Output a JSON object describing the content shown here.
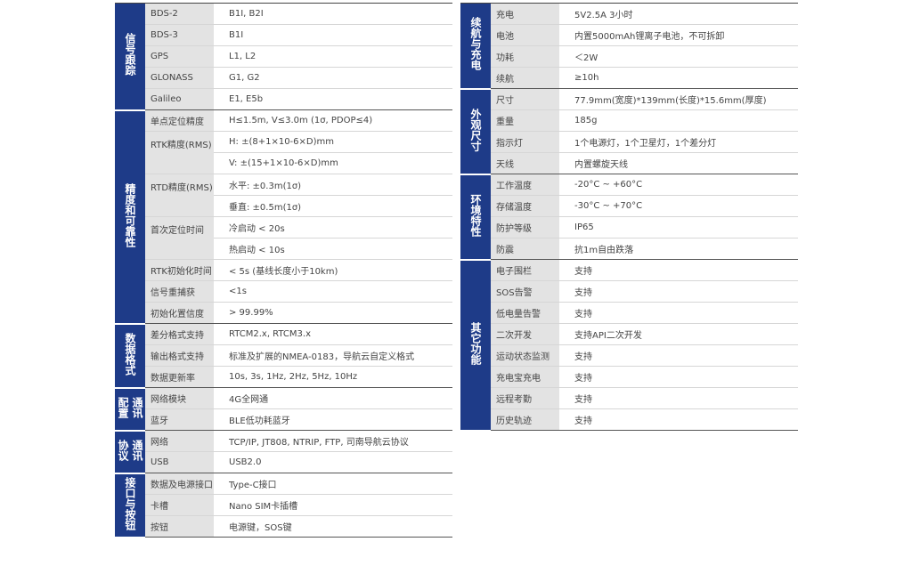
{
  "left": [
    {
      "category": "信号跟踪",
      "layout": "single",
      "rows": [
        {
          "label": "BDS-2",
          "value": "B1I, B2I"
        },
        {
          "label": "BDS-3",
          "value": "B1I"
        },
        {
          "label": "GPS",
          "value": "L1, L2"
        },
        {
          "label": "GLONASS",
          "value": "G1, G2"
        },
        {
          "label": "Galileo",
          "value": "E1, E5b"
        }
      ]
    },
    {
      "category": "精度和可靠性",
      "layout": "single",
      "rows": [
        {
          "label": "单点定位精度",
          "value": "H≤1.5m, V≤3.0m (1σ, PDOP≤4)"
        },
        {
          "label": "RTK精度(RMS)",
          "values": [
            "H: ±(8+1×10-6×D)mm",
            "V: ±(15+1×10-6×D)mm"
          ]
        },
        {
          "label": "RTD精度(RMS)",
          "values": [
            "水平: ±0.3m(1σ)",
            "垂直: ±0.5m(1σ)"
          ]
        },
        {
          "label": "首次定位时间",
          "values": [
            "冷启动 < 20s",
            "热启动 < 10s"
          ]
        },
        {
          "label": "RTK初始化时间",
          "value": "< 5s (基线长度小于10km)"
        },
        {
          "label": "信号重捕获",
          "value": "<1s"
        },
        {
          "label": "初始化置信度",
          "value": "> 99.99%"
        }
      ]
    },
    {
      "category": "数据格式",
      "layout": "single",
      "rows": [
        {
          "label": "差分格式支持",
          "value": "RTCM2.x, RTCM3.x"
        },
        {
          "label": "输出格式支持",
          "value": "标准及扩展的NMEA-0183，导航云自定义格式"
        },
        {
          "label": "数据更新率",
          "value": "10s, 3s, 1Hz, 2Hz, 5Hz, 10Hz"
        }
      ]
    },
    {
      "category": "通讯配置",
      "layout": "double",
      "rows": [
        {
          "label": "网络模块",
          "value": "4G全网通"
        },
        {
          "label": "蓝牙",
          "value": "BLE低功耗蓝牙"
        }
      ]
    },
    {
      "category": "通讯协议",
      "layout": "double",
      "rows": [
        {
          "label": "网络",
          "value": "TCP/IP, JT808, NTRIP, FTP, 司南导航云协议"
        },
        {
          "label": "USB",
          "value": "USB2.0"
        }
      ]
    },
    {
      "category": "接口与按钮",
      "layout": "single",
      "rows": [
        {
          "label": "数据及电源接口",
          "value": "Type-C接口"
        },
        {
          "label": "卡槽",
          "value": "Nano SIM卡插槽"
        },
        {
          "label": "按钮",
          "value": "电源键，SOS键"
        }
      ]
    }
  ],
  "right": [
    {
      "category": "续航与充电",
      "layout": "single",
      "rows": [
        {
          "label": "充电",
          "value": "5V2.5A  3小时"
        },
        {
          "label": "电池",
          "value": "内置5000mAh锂离子电池，不可拆卸"
        },
        {
          "label": "功耗",
          "value": "＜2W"
        },
        {
          "label": "续航",
          "value": "≥10h"
        }
      ]
    },
    {
      "category": "外观尺寸",
      "layout": "single",
      "rows": [
        {
          "label": "尺寸",
          "value": "77.9mm(宽度)*139mm(长度)*15.6mm(厚度)"
        },
        {
          "label": "重量",
          "value": "185g"
        },
        {
          "label": "指示灯",
          "value": "1个电源灯，1个卫星灯，1个差分灯"
        },
        {
          "label": "天线",
          "value": "内置螺旋天线"
        }
      ]
    },
    {
      "category": "环境特性",
      "layout": "single",
      "rows": [
        {
          "label": "工作温度",
          "value": "-20°C ~ +60°C"
        },
        {
          "label": "存储温度",
          "value": "-30°C ~ +70°C"
        },
        {
          "label": "防护等级",
          "value": "IP65"
        },
        {
          "label": "防震",
          "value": "抗1m自由跌落"
        }
      ]
    },
    {
      "category": "其它功能",
      "layout": "single",
      "rows": [
        {
          "label": "电子围栏",
          "value": "支持"
        },
        {
          "label": "SOS告警",
          "value": "支持"
        },
        {
          "label": "低电量告警",
          "value": "支持"
        },
        {
          "label": "二次开发",
          "value": "支持API二次开发"
        },
        {
          "label": "运动状态监测",
          "value": "支持"
        },
        {
          "label": "充电宝充电",
          "value": "支持"
        },
        {
          "label": "远程考勤",
          "value": "支持"
        },
        {
          "label": "历史轨迹",
          "value": "支持"
        }
      ]
    }
  ]
}
